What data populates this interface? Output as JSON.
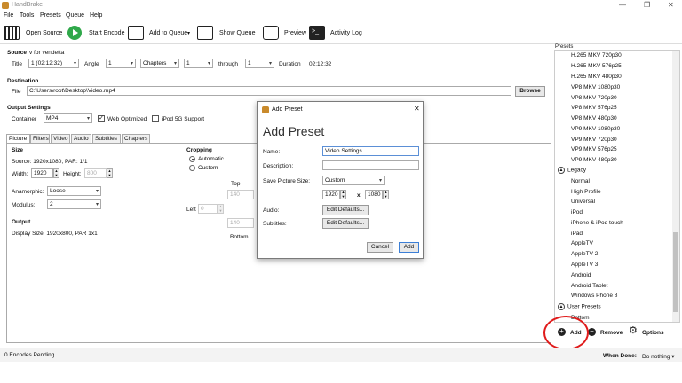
{
  "window": {
    "title": "HandBrake",
    "minimize": "—",
    "maximize": "❐",
    "close": "✕"
  },
  "menu": [
    "File",
    "Tools",
    "Presets",
    "Queue",
    "Help"
  ],
  "toolbar": {
    "open_source": "Open Source",
    "start_encode": "Start Encode",
    "add_to_queue": "Add to Queue",
    "show_queue": "Show Queue",
    "preview": "Preview",
    "activity_log": "Activity Log"
  },
  "source": {
    "heading": "Source",
    "name": "v for vendetta",
    "title_label": "Title",
    "title_value": "1 (02:12:32)",
    "angle_label": "Angle",
    "angle_value": "1",
    "range_type": "Chapters",
    "range_start": "1",
    "through_label": "through",
    "range_end": "1",
    "duration_label": "Duration",
    "duration_value": "02:12:32"
  },
  "destination": {
    "heading": "Destination",
    "file_label": "File",
    "file_value": "C:\\Users\\root\\Desktop\\Video.mp4",
    "browse": "Browse"
  },
  "output": {
    "heading": "Output Settings",
    "container_label": "Container",
    "container_value": "MP4",
    "web_optimized": "Web Optimized",
    "ipod_support": "iPod 5G Support"
  },
  "tabs": [
    "Picture",
    "Filters",
    "Video",
    "Audio",
    "Subtitles",
    "Chapters"
  ],
  "picture": {
    "size_heading": "Size",
    "source_line": "Source:  1920x1080, PAR: 1/1",
    "width_label": "Width:",
    "width_value": "1920",
    "height_label": "Height:",
    "height_value": "800",
    "anamorphic_label": "Anamorphic:",
    "anamorphic_value": "Loose",
    "modulus_label": "Modulus:",
    "modulus_value": "2",
    "output_heading": "Output",
    "display_size": "Display Size: 1920x800,  PAR 1x1",
    "cropping_heading": "Cropping",
    "automatic": "Automatic",
    "custom": "Custom",
    "top_label": "Top",
    "top_value": "140",
    "left_label": "Left",
    "left_value": "0",
    "bottom_label": "Bottom",
    "bottom_value": "140"
  },
  "presets": {
    "heading": "Presets",
    "items_top": [
      "H.265 MKV 720p30",
      "H.265 MKV 576p25",
      "H.265 MKV 480p30",
      "VP8 MKV 1080p30",
      "VP8 MKV 720p30",
      "VP8 MKV 576p25",
      "VP8 MKV 480p30",
      "VP9 MKV 1080p30",
      "VP9 MKV 720p30",
      "VP9 MKV 576p25",
      "VP9 MKV 480p30"
    ],
    "legacy_label": "Legacy",
    "legacy_items": [
      "Normal",
      "High Profile",
      "Universal",
      "iPod",
      "iPhone & iPod touch",
      "iPad",
      "AppleTV",
      "AppleTV 2",
      "AppleTV 3",
      "Android",
      "Android Tablet",
      "Windows Phone 8"
    ],
    "user_label": "User Presets",
    "user_items": [
      "Bottom"
    ],
    "add": "Add",
    "remove": "Remove",
    "options": "Options"
  },
  "status": {
    "pending": "0 Encodes Pending",
    "when_done_label": "When Done:",
    "when_done_value": "Do nothing"
  },
  "dialog": {
    "title": "Add Preset",
    "heading": "Add Preset",
    "name_label": "Name:",
    "name_value": "Video Settings",
    "description_label": "Description:",
    "description_value": "",
    "save_picture_label": "Save Picture Size:",
    "save_picture_value": "Custom",
    "pic_width": "1920",
    "x_sep": "x",
    "pic_height": "1080",
    "audio_label": "Audio:",
    "subtitles_label": "Subtitles:",
    "edit_defaults": "Edit Defaults...",
    "cancel": "Cancel",
    "add": "Add",
    "close": "✕"
  }
}
